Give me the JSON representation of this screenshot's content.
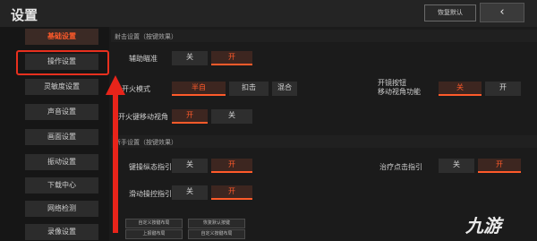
{
  "header": {
    "title": "设置",
    "restore_label": "恢复默认",
    "close_icon": "‹"
  },
  "sidebar": {
    "items": [
      {
        "label": "基础设置",
        "active": true
      },
      {
        "label": "操作设置",
        "active": false
      },
      {
        "label": "灵敏度设置",
        "active": false
      },
      {
        "label": "声音设置",
        "active": false
      },
      {
        "label": "画面设置",
        "active": false
      },
      {
        "label": "振动设置",
        "active": false
      },
      {
        "label": "下载中心",
        "active": false
      },
      {
        "label": "网络检测",
        "active": false
      },
      {
        "label": "录像设置",
        "active": false
      }
    ]
  },
  "sections": {
    "s1": "射击设置（按键效果）",
    "s2": "新手设置（按键效果）"
  },
  "settings": {
    "aim_assist": {
      "label": "辅助瞄准",
      "off": "关",
      "on": "开"
    },
    "fire_mode": {
      "label": "开火模式",
      "opt1": "半自",
      "opt2": "扣击",
      "opt3": "混合"
    },
    "side_fire": {
      "label": "开火键移动视角",
      "off": "关",
      "on": "开"
    },
    "sprint_view": {
      "label": "开镜按钮\n移动视角功能",
      "off": "关",
      "on": "开"
    },
    "guide1": {
      "label": "键操纵态指引",
      "off": "关",
      "on": "开"
    },
    "guide2": {
      "label": "治疗点击指引",
      "off": "关",
      "on": "开"
    },
    "guide3": {
      "label": "滑动操控指引",
      "off": "关",
      "on": "开"
    }
  },
  "bottom_buttons": [
    "自定义按键布局",
    "恢复默认按键",
    "上报键布局",
    "自定义按键布局"
  ],
  "watermark": "九游",
  "colors": {
    "accent": "#ff5a2a",
    "annotation": "#e8241a"
  }
}
